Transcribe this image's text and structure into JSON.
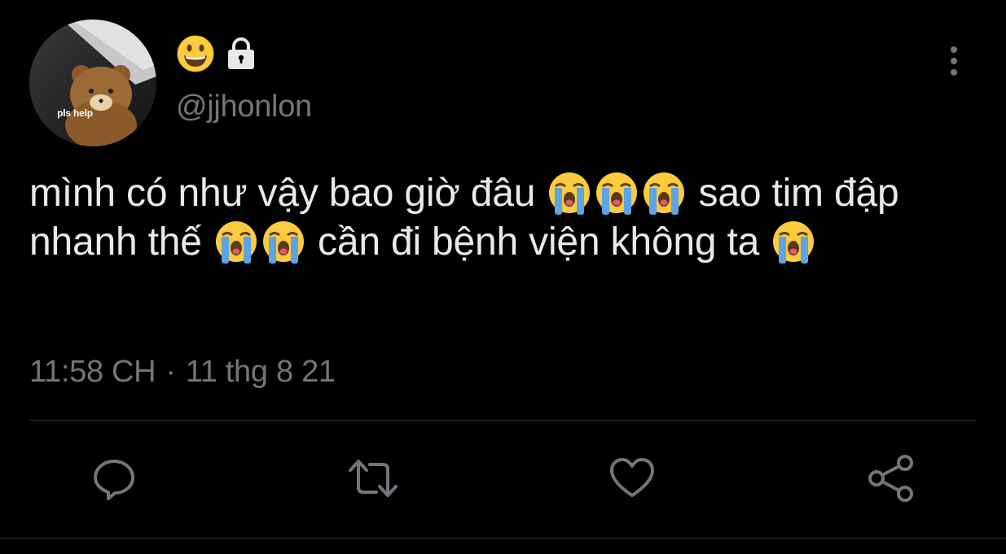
{
  "tweet": {
    "user": {
      "display_name_icon": "grinning-face-emoji",
      "protected_icon": "lock-icon",
      "handle": "@jjhonlon",
      "avatar_caption": "pls help"
    },
    "menu_icon": "more-vertical-icon",
    "text_segments": [
      "mình có như vậy bao giờ đâu",
      "sao tim đập nhanh thế",
      "cần đi bệnh viện không ta"
    ],
    "inline_emoji": "loudly-crying-face-emoji",
    "time": "11:58 CH",
    "separator": "·",
    "date": "11 thg 8 21"
  },
  "actions": [
    {
      "name": "reply",
      "icon": "reply-icon"
    },
    {
      "name": "retweet",
      "icon": "retweet-icon"
    },
    {
      "name": "like",
      "icon": "heart-icon"
    },
    {
      "name": "share",
      "icon": "share-icon"
    }
  ],
  "colors": {
    "background": "#000000",
    "text": "#e7e9ea",
    "secondary_text": "#71767b",
    "icon": "#71767b",
    "divider": "#2f3336"
  }
}
